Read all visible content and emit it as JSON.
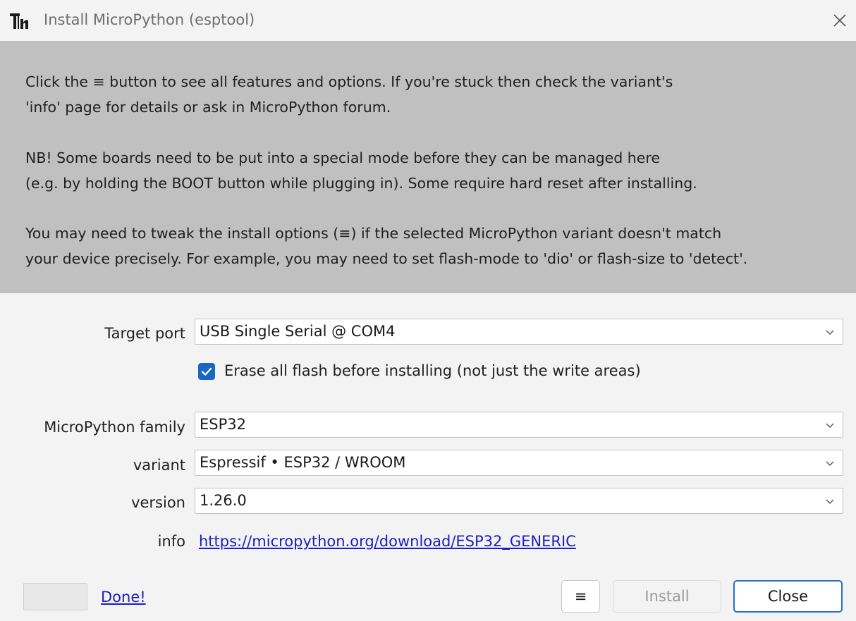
{
  "window": {
    "title": "Install MicroPython (esptool)",
    "icon": "thonny-app-icon"
  },
  "info_panel": {
    "lines": [
      "Click the ≡ button to see all features and options. If you're stuck then check the variant's",
      "'info' page for details or ask in MicroPython forum.",
      "NB! Some boards need to be put into a special mode before they can be managed here",
      "(e.g. by holding the BOOT button while plugging in). Some require hard reset after installing.",
      "You may need to tweak the install options (≡) if the selected MicroPython variant doesn't match",
      "your device precisely. For example, you may need to set flash-mode to 'dio' or flash-size to 'detect'."
    ]
  },
  "form": {
    "target_port": {
      "label": "Target port",
      "value": "USB Single Serial @ COM4"
    },
    "erase_flash": {
      "label": "Erase all flash before installing (not just the write areas)",
      "checked": true
    },
    "family": {
      "label": "MicroPython family",
      "value": "ESP32"
    },
    "variant": {
      "label": "variant",
      "value": "Espressif • ESP32 / WROOM"
    },
    "version": {
      "label": "version",
      "value": "1.26.0"
    },
    "info": {
      "label": "info",
      "link": "https://micropython.org/download/ESP32_GENERIC"
    }
  },
  "footer": {
    "status_link": "Done!",
    "menu_label": "≡",
    "install_label": "Install",
    "install_enabled": false,
    "close_label": "Close"
  },
  "colors": {
    "accent": "#1a66c4",
    "info_panel_bg": "#c0c0c0",
    "link": "#1c1cc8"
  }
}
